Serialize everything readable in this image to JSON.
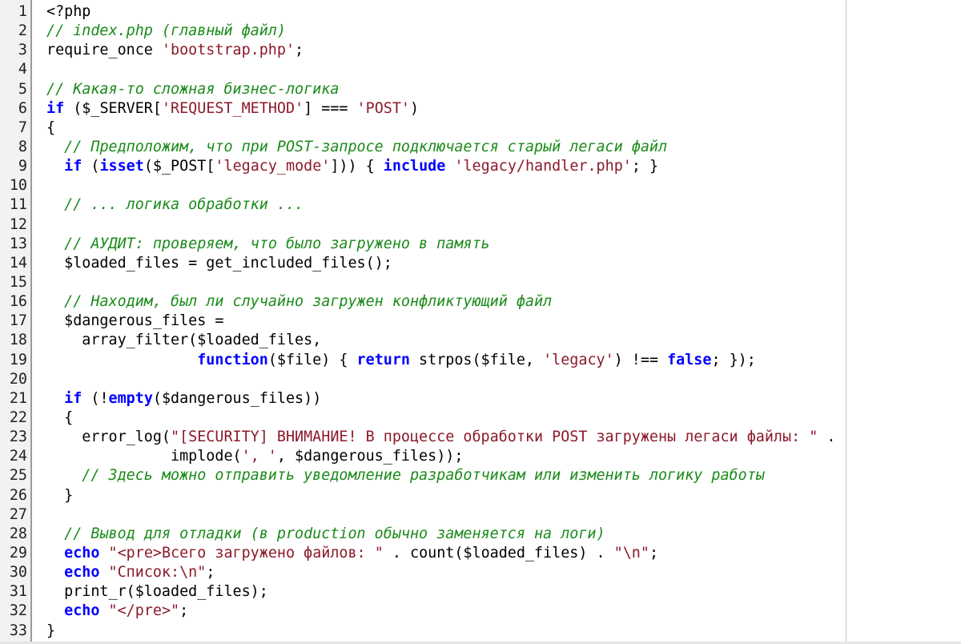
{
  "editor": {
    "language": "php",
    "colors": {
      "keyword": "#0000ff",
      "string": "#8b1a2a",
      "comment": "#1a8a1a",
      "plain": "#000000",
      "gutter_bg": "#f2f2f2"
    },
    "lines": [
      {
        "n": "1",
        "tokens": [
          {
            "t": "pl",
            "v": "<?php"
          }
        ]
      },
      {
        "n": "2",
        "tokens": [
          {
            "t": "cm",
            "v": "// index.php (главный файл)"
          }
        ]
      },
      {
        "n": "3",
        "tokens": [
          {
            "t": "pl",
            "v": "require_once "
          },
          {
            "t": "str",
            "v": "'bootstrap.php'"
          },
          {
            "t": "pl",
            "v": ";"
          }
        ]
      },
      {
        "n": "4",
        "tokens": []
      },
      {
        "n": "5",
        "tokens": [
          {
            "t": "cm",
            "v": "// Какая-то сложная бизнес-логика"
          }
        ]
      },
      {
        "n": "6",
        "tokens": [
          {
            "t": "kw",
            "v": "if"
          },
          {
            "t": "pl",
            "v": " ($_SERVER["
          },
          {
            "t": "str",
            "v": "'REQUEST_METHOD'"
          },
          {
            "t": "pl",
            "v": "] === "
          },
          {
            "t": "str",
            "v": "'POST'"
          },
          {
            "t": "pl",
            "v": ")"
          }
        ]
      },
      {
        "n": "7",
        "tokens": [
          {
            "t": "pl",
            "v": "{"
          }
        ]
      },
      {
        "n": "8",
        "tokens": [
          {
            "t": "pl",
            "v": "  "
          },
          {
            "t": "cm",
            "v": "// Предположим, что при POST-запросе подключается старый легаси файл"
          }
        ]
      },
      {
        "n": "9",
        "tokens": [
          {
            "t": "pl",
            "v": "  "
          },
          {
            "t": "kw",
            "v": "if"
          },
          {
            "t": "pl",
            "v": " ("
          },
          {
            "t": "kw",
            "v": "isset"
          },
          {
            "t": "pl",
            "v": "($_POST["
          },
          {
            "t": "str",
            "v": "'legacy_mode'"
          },
          {
            "t": "pl",
            "v": "])) { "
          },
          {
            "t": "kw",
            "v": "include"
          },
          {
            "t": "pl",
            "v": " "
          },
          {
            "t": "str",
            "v": "'legacy/handler.php'"
          },
          {
            "t": "pl",
            "v": "; }"
          }
        ]
      },
      {
        "n": "10",
        "tokens": []
      },
      {
        "n": "11",
        "tokens": [
          {
            "t": "pl",
            "v": "  "
          },
          {
            "t": "cm",
            "v": "// ... логика обработки ..."
          }
        ]
      },
      {
        "n": "12",
        "tokens": []
      },
      {
        "n": "13",
        "tokens": [
          {
            "t": "pl",
            "v": "  "
          },
          {
            "t": "cm",
            "v": "// АУДИТ: проверяем, что было загружено в память"
          }
        ]
      },
      {
        "n": "14",
        "tokens": [
          {
            "t": "pl",
            "v": "  $loaded_files = get_included_files();"
          }
        ]
      },
      {
        "n": "15",
        "tokens": []
      },
      {
        "n": "16",
        "tokens": [
          {
            "t": "pl",
            "v": "  "
          },
          {
            "t": "cm",
            "v": "// Находим, был ли случайно загружен конфликтующий файл"
          }
        ]
      },
      {
        "n": "17",
        "tokens": [
          {
            "t": "pl",
            "v": "  $dangerous_files ="
          }
        ]
      },
      {
        "n": "18",
        "tokens": [
          {
            "t": "pl",
            "v": "    array_filter($loaded_files,"
          }
        ]
      },
      {
        "n": "19",
        "tokens": [
          {
            "t": "pl",
            "v": "                 "
          },
          {
            "t": "kw",
            "v": "function"
          },
          {
            "t": "pl",
            "v": "($file) { "
          },
          {
            "t": "kw",
            "v": "return"
          },
          {
            "t": "pl",
            "v": " strpos($file, "
          },
          {
            "t": "str",
            "v": "'legacy'"
          },
          {
            "t": "pl",
            "v": ") !== "
          },
          {
            "t": "kw",
            "v": "false"
          },
          {
            "t": "pl",
            "v": "; });"
          }
        ]
      },
      {
        "n": "20",
        "tokens": []
      },
      {
        "n": "21",
        "tokens": [
          {
            "t": "pl",
            "v": "  "
          },
          {
            "t": "kw",
            "v": "if"
          },
          {
            "t": "pl",
            "v": " (!"
          },
          {
            "t": "kw",
            "v": "empty"
          },
          {
            "t": "pl",
            "v": "($dangerous_files))"
          }
        ]
      },
      {
        "n": "22",
        "tokens": [
          {
            "t": "pl",
            "v": "  {"
          }
        ]
      },
      {
        "n": "23",
        "tokens": [
          {
            "t": "pl",
            "v": "    error_log("
          },
          {
            "t": "str",
            "v": "\"[SECURITY] ВНИМАНИЕ! В процессе обработки POST загружены легаси файлы: \""
          },
          {
            "t": "pl",
            "v": " ."
          }
        ]
      },
      {
        "n": "24",
        "tokens": [
          {
            "t": "pl",
            "v": "              implode("
          },
          {
            "t": "str",
            "v": "', '"
          },
          {
            "t": "pl",
            "v": ", $dangerous_files));"
          }
        ]
      },
      {
        "n": "25",
        "tokens": [
          {
            "t": "pl",
            "v": "    "
          },
          {
            "t": "cm",
            "v": "// Здесь можно отправить уведомление разработчикам или изменить логику работы"
          }
        ]
      },
      {
        "n": "26",
        "tokens": [
          {
            "t": "pl",
            "v": "  }"
          }
        ]
      },
      {
        "n": "27",
        "tokens": []
      },
      {
        "n": "28",
        "tokens": [
          {
            "t": "pl",
            "v": "  "
          },
          {
            "t": "cm",
            "v": "// Вывод для отладки (в production обычно заменяется на логи)"
          }
        ]
      },
      {
        "n": "29",
        "tokens": [
          {
            "t": "pl",
            "v": "  "
          },
          {
            "t": "kw",
            "v": "echo"
          },
          {
            "t": "pl",
            "v": " "
          },
          {
            "t": "str",
            "v": "\"<pre>Всего загружено файлов: \""
          },
          {
            "t": "pl",
            "v": " . count($loaded_files) . "
          },
          {
            "t": "str",
            "v": "\"\\n\""
          },
          {
            "t": "pl",
            "v": ";"
          }
        ]
      },
      {
        "n": "30",
        "tokens": [
          {
            "t": "pl",
            "v": "  "
          },
          {
            "t": "kw",
            "v": "echo"
          },
          {
            "t": "pl",
            "v": " "
          },
          {
            "t": "str",
            "v": "\"Список:\\n\""
          },
          {
            "t": "pl",
            "v": ";"
          }
        ]
      },
      {
        "n": "31",
        "tokens": [
          {
            "t": "pl",
            "v": "  print_r($loaded_files);"
          }
        ]
      },
      {
        "n": "32",
        "tokens": [
          {
            "t": "pl",
            "v": "  "
          },
          {
            "t": "kw",
            "v": "echo"
          },
          {
            "t": "pl",
            "v": " "
          },
          {
            "t": "str",
            "v": "\"</pre>\""
          },
          {
            "t": "pl",
            "v": ";"
          }
        ]
      },
      {
        "n": "33",
        "tokens": [
          {
            "t": "pl",
            "v": "}"
          }
        ]
      }
    ]
  }
}
